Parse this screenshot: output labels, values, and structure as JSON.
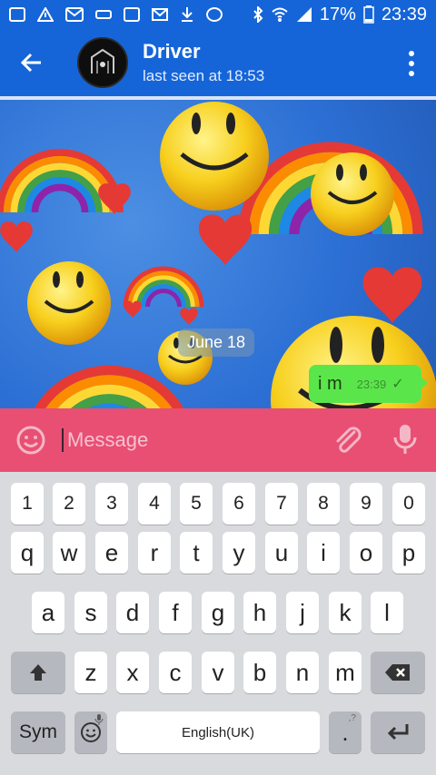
{
  "status_bar": {
    "battery": "17%",
    "time": "23:39"
  },
  "header": {
    "title": "Driver",
    "subtitle": "last seen at 18:53"
  },
  "chat": {
    "date_label": "June 18",
    "messages": [
      {
        "text": "i m",
        "time": "23:39",
        "status_icon": "check-icon"
      }
    ]
  },
  "composer": {
    "placeholder": "Message"
  },
  "keyboard": {
    "number_row": [
      "1",
      "2",
      "3",
      "4",
      "5",
      "6",
      "7",
      "8",
      "9",
      "0"
    ],
    "row1": [
      "q",
      "w",
      "e",
      "r",
      "t",
      "y",
      "u",
      "i",
      "o",
      "p"
    ],
    "row2": [
      "a",
      "s",
      "d",
      "f",
      "g",
      "h",
      "j",
      "k",
      "l"
    ],
    "row3": [
      "z",
      "x",
      "c",
      "v",
      "b",
      "n",
      "m"
    ],
    "sym_label": "Sym",
    "space_label": "English(UK)",
    "period_label": ".",
    "period_hint": ",?"
  },
  "colors": {
    "header_blue": "#1565d8",
    "input_pink": "#e84f73",
    "bubble_green": "#5ae64a"
  }
}
